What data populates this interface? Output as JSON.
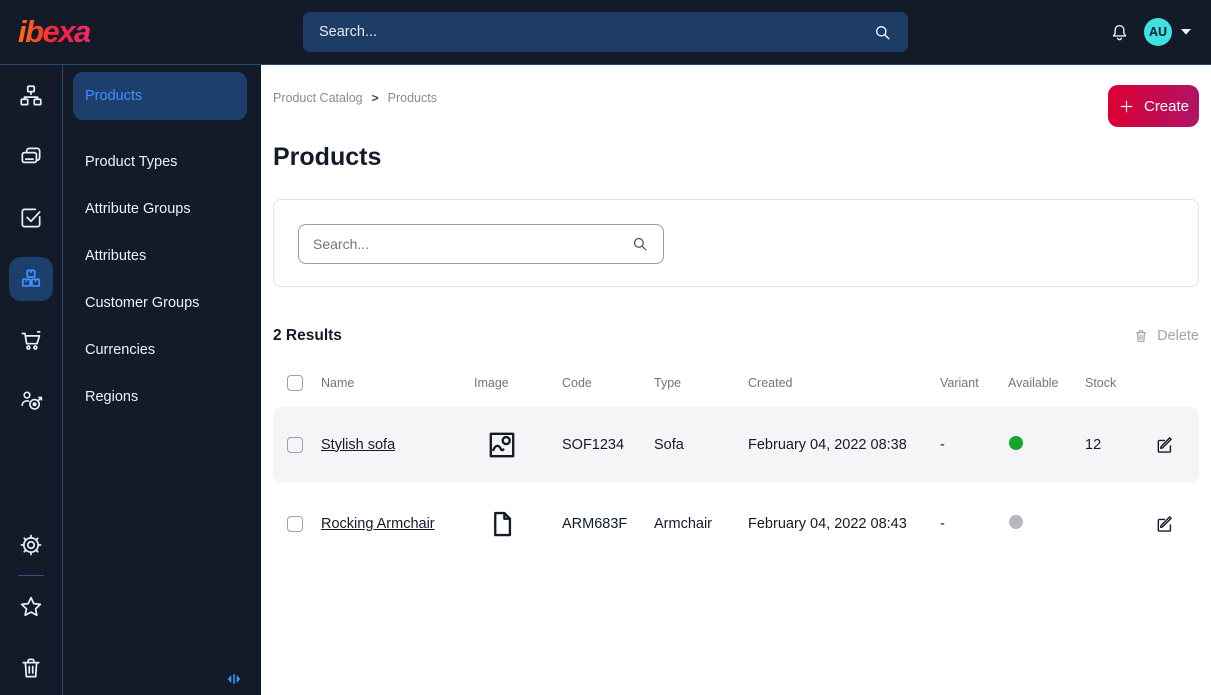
{
  "colors": {
    "accent_blue": "#4191ff",
    "topbar_bg": "#131a28",
    "create_gradient_start": "#dc0032",
    "create_gradient_end": "#b01368",
    "available_green": "#17a52f",
    "unavailable_grey": "#b5b8be",
    "avatar_bg": "#3fe1e0",
    "avatar_text": "#d6157e"
  },
  "topbar": {
    "logo_text": "ibexa",
    "search_placeholder": "Search...",
    "user_initials": "AU",
    "icons": [
      "bell-icon",
      "caret-down-icon",
      "search-icon"
    ]
  },
  "iconbar": {
    "top_icons": [
      "sitemap-icon",
      "pages-icon",
      "checklist-icon",
      "product-catalog-icon",
      "cart-icon",
      "customer-target-icon"
    ],
    "bottom_icons": [
      "gear-icon",
      "star-icon",
      "trash-icon"
    ],
    "active_icon": "product-catalog-icon"
  },
  "sidebar": {
    "items": [
      {
        "label": "Products",
        "active": true
      },
      {
        "label": "Product Types",
        "active": false
      },
      {
        "label": "Attribute Groups",
        "active": false
      },
      {
        "label": "Attributes",
        "active": false
      },
      {
        "label": "Customer Groups",
        "active": false
      },
      {
        "label": "Currencies",
        "active": false
      },
      {
        "label": "Regions",
        "active": false
      }
    ],
    "collapse_icon": "collapse-panel-icon"
  },
  "main": {
    "breadcrumb": {
      "items": [
        "Product Catalog",
        "Products"
      ],
      "separator": ">"
    },
    "create_button": "Create",
    "page_title": "Products",
    "filter": {
      "search_placeholder": "Search..."
    },
    "results_label": "2 Results",
    "delete_button": "Delete",
    "table": {
      "headers": [
        "Name",
        "Image",
        "Code",
        "Type",
        "Created",
        "Variant",
        "Available",
        "Stock"
      ],
      "rows": [
        {
          "name": "Stylish sofa",
          "image_icon": "image-icon",
          "code": "SOF1234",
          "type": "Sofa",
          "created": "February 04, 2022 08:38",
          "variant": "-",
          "available": "available",
          "stock": "12"
        },
        {
          "name": "Rocking Armchair",
          "image_icon": "file-icon",
          "code": "ARM683F",
          "type": "Armchair",
          "created": "February 04, 2022 08:43",
          "variant": "-",
          "available": "unavailable",
          "stock": ""
        }
      ]
    }
  }
}
